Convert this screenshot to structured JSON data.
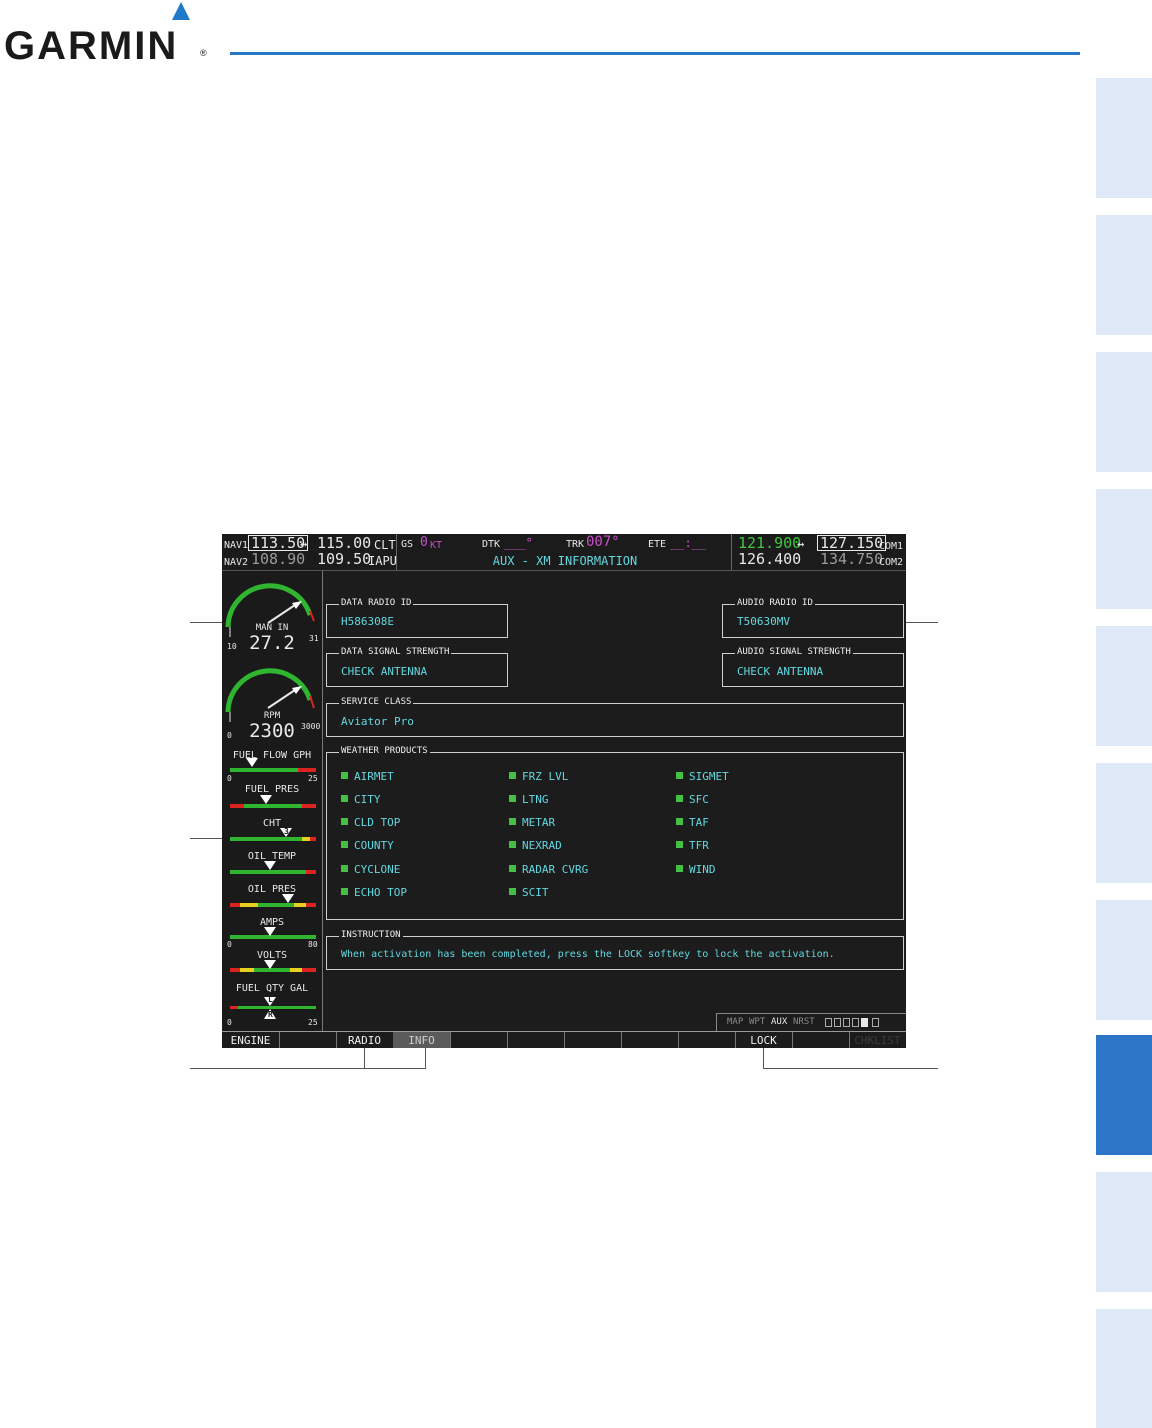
{
  "manual": {
    "brand": "GARMIN",
    "registered": "®"
  },
  "side_tabs": {
    "count": 10,
    "active_index": 7
  },
  "header": {
    "nav1": {
      "label": "NAV1",
      "active": "113.50",
      "standby": "115.00",
      "id": "CLT"
    },
    "nav2": {
      "label": "NAV2",
      "active": "108.90",
      "standby": "109.50",
      "id": "IAPU"
    },
    "swap_symbol": "↔",
    "gs": {
      "label": "GS",
      "value": "0",
      "unit": "KT"
    },
    "dtk": {
      "label": "DTK",
      "value": "___°"
    },
    "trk": {
      "label": "TRK",
      "value": "007°"
    },
    "ete": {
      "label": "ETE",
      "value": "__:__"
    },
    "page_title": "AUX - XM INFORMATION",
    "com1": {
      "label": "COM1",
      "active": "121.900",
      "standby": "127.150"
    },
    "com2": {
      "label": "COM2",
      "active": "126.400",
      "standby": "134.750"
    }
  },
  "engine": {
    "man_in": {
      "label": "MAN IN",
      "value": "27.2",
      "min": "10",
      "max": "31"
    },
    "rpm": {
      "label": "RPM",
      "value": "2300",
      "min": "0",
      "max": "3000"
    },
    "fuel_flow": {
      "label": "FUEL FLOW GPH",
      "min": "0",
      "max": "25"
    },
    "fuel_pres": {
      "label": "FUEL PRES"
    },
    "cht": {
      "label": "CHT",
      "marker": "3"
    },
    "oil_temp": {
      "label": "OIL TEMP"
    },
    "oil_pres": {
      "label": "OIL PRES"
    },
    "amps": {
      "label": "AMPS",
      "min": "0",
      "max": "80"
    },
    "volts": {
      "label": "VOLTS"
    },
    "fuel_qty": {
      "label": "FUEL QTY GAL",
      "left": "L",
      "right": "R",
      "min": "0",
      "max": "25"
    }
  },
  "xm": {
    "data_radio_id": {
      "title": "DATA RADIO ID",
      "value": "H586308E"
    },
    "audio_radio_id": {
      "title": "AUDIO RADIO ID",
      "value": "T50630MV"
    },
    "data_signal": {
      "title": "DATA SIGNAL STRENGTH",
      "value": "CHECK ANTENNA"
    },
    "audio_signal": {
      "title": "AUDIO SIGNAL STRENGTH",
      "value": "CHECK ANTENNA"
    },
    "service_class": {
      "title": "SERVICE CLASS",
      "value": "Aviator Pro"
    },
    "weather_products": {
      "title": "WEATHER PRODUCTS",
      "col1": [
        "AIRMET",
        "CITY",
        "CLD TOP",
        "COUNTY",
        "CYCLONE",
        "ECHO TOP"
      ],
      "col2": [
        "FRZ LVL",
        "LTNG",
        "METAR",
        "NEXRAD",
        "RADAR CVRG",
        "SCIT"
      ],
      "col3": [
        "SIGMET",
        "SFC",
        "TAF",
        "TFR",
        "WIND"
      ]
    },
    "instruction": {
      "title": "INSTRUCTION",
      "value": "When activation has been completed, press the LOCK softkey to lock the activation."
    }
  },
  "page_group": {
    "map": "MAP",
    "wpt": "WPT",
    "aux": "AUX",
    "nrst": "NRST"
  },
  "softkeys": [
    "ENGINE",
    "",
    "RADIO",
    "INFO",
    "",
    "",
    "",
    "",
    "",
    "LOCK",
    "",
    "CHKLIST"
  ]
}
